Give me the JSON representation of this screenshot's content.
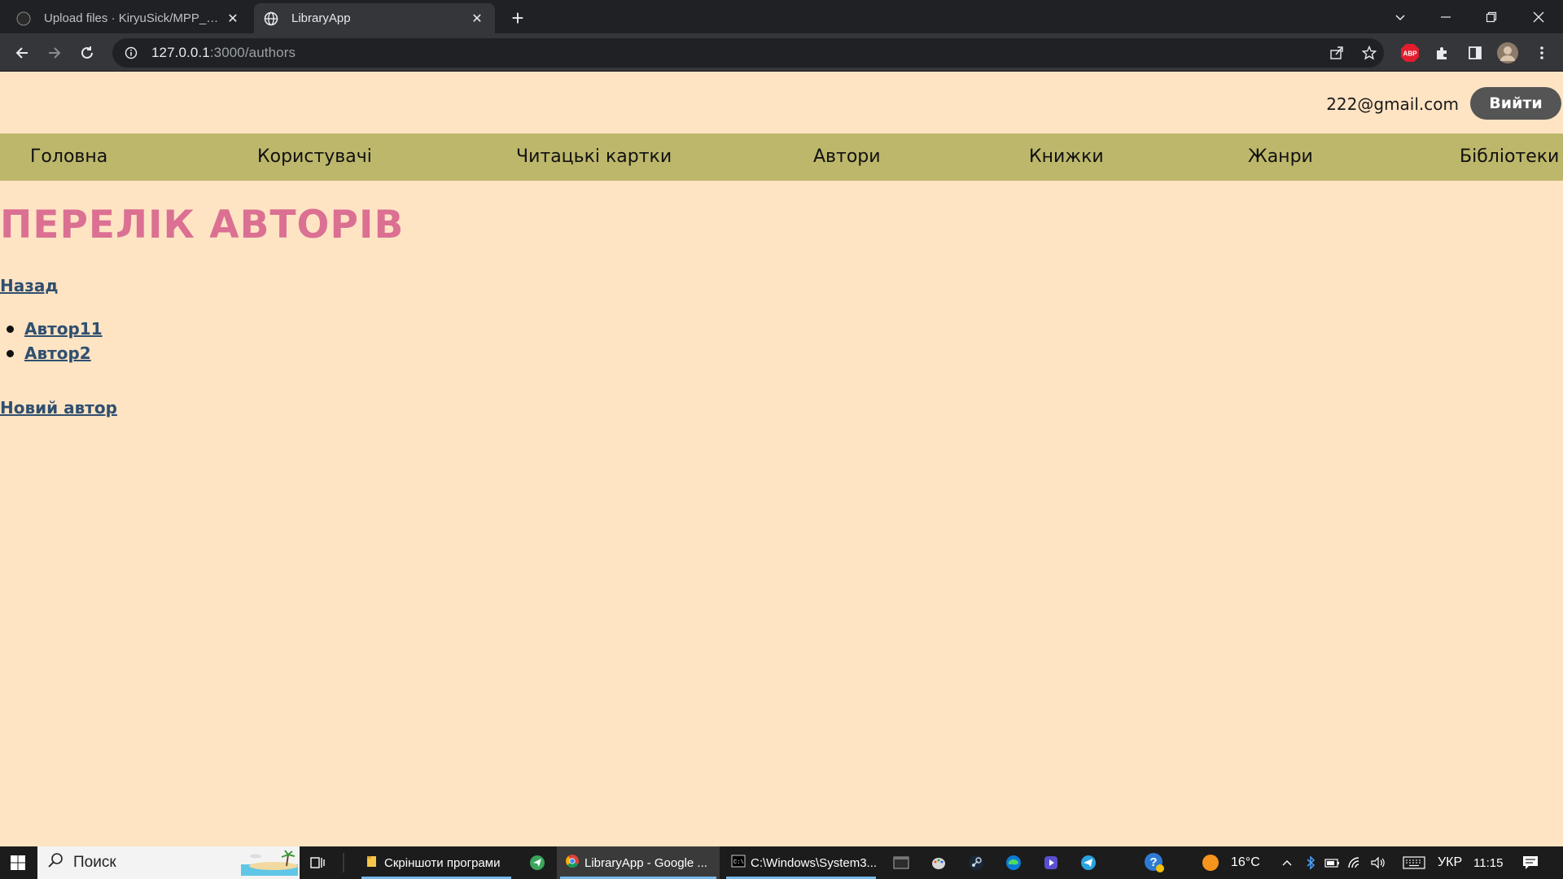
{
  "browser": {
    "tabs": [
      {
        "title": "Upload files · KiryuSick/MPP_Fin...",
        "active": false
      },
      {
        "title": "LibraryApp",
        "active": true
      }
    ],
    "url_host": "127.0.0.1",
    "url_path": ":3000/authors"
  },
  "header": {
    "user_email": "222@gmail.com",
    "logout_label": "Вийти"
  },
  "nav": {
    "items": [
      {
        "label": "Головна"
      },
      {
        "label": "Користувачі"
      },
      {
        "label": "Читацькі картки"
      },
      {
        "label": "Автори"
      },
      {
        "label": "Книжки"
      },
      {
        "label": "Жанри"
      },
      {
        "label": "Бібліотеки"
      }
    ]
  },
  "main": {
    "title": "ПЕРЕЛІК АВТОРІВ",
    "back_link": "Назад",
    "authors": [
      {
        "name": "Автор11"
      },
      {
        "name": "Автор2"
      }
    ],
    "new_author_link": "Новий автор"
  },
  "taskbar": {
    "search_placeholder": "Поиск",
    "apps": [
      {
        "label": "Скріншоти програми"
      },
      {
        "label": "LibraryApp - Google ..."
      },
      {
        "label": "C:\\Windows\\System3..."
      }
    ],
    "temperature": "16°C",
    "language": "УКР",
    "time": "11:15"
  },
  "colors": {
    "page_bg": "#ffe4c4",
    "nav_bg": "#bdb76b",
    "title": "#db7093",
    "link": "#2f4f6f",
    "logout_bg": "#555555"
  }
}
